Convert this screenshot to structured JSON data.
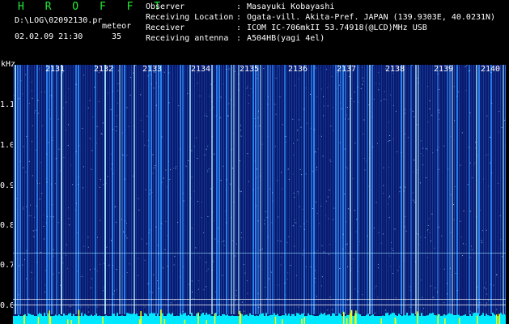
{
  "header": {
    "title": "H R O F F T",
    "file": "D:\\LOG\\02092130.pr",
    "meteor_label": "meteor",
    "datetime": "02.02.09 21:30",
    "count": "35",
    "meta": [
      {
        "key": "Observer",
        "value": "Masayuki Kobayashi"
      },
      {
        "key": "Receiving Location",
        "value": "Ogata-vill. Akita-Pref. JAPAN (139.9303E, 40.0231N)"
      },
      {
        "key": "Receiver",
        "value": "ICOM IC-706mkII 53.74918(@LCD)MHz USB"
      },
      {
        "key": "Receiving antenna",
        "value": "A504HB(yagi 4el)"
      }
    ],
    "separator": ":"
  },
  "axis": {
    "unit": "kHz",
    "y_ticks": [
      "1.1",
      "1.0",
      "0.9",
      "0.8",
      "0.7",
      "0.6"
    ],
    "x_labels": [
      "2131",
      "2132",
      "2133",
      "2134",
      "2135",
      "2136",
      "2137",
      "2138",
      "2139",
      "2140"
    ]
  },
  "colors": {
    "background": "#000000",
    "waterfall_base": "#0a1a6e",
    "signal": "#2f8fff",
    "hot": "#9fe0ff",
    "cyan_fill": "#00e8ff",
    "yellow": "#ffff00",
    "title_green": "#22ee33"
  }
}
